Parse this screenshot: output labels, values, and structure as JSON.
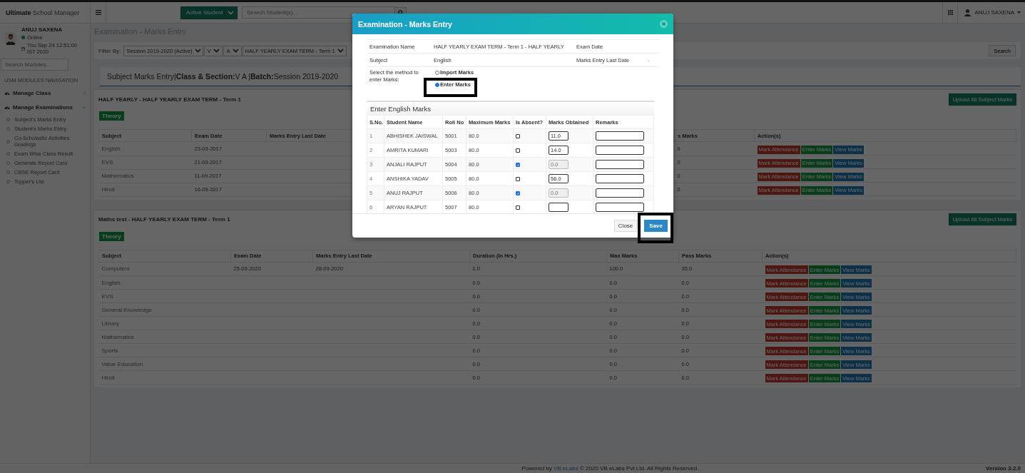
{
  "topbar": {
    "brand": "**Ultimate** School Manager",
    "active_button": "Active Student",
    "search_placeholder": "Search Student(s)...",
    "user": "ANUJ SAXENA"
  },
  "sidebar": {
    "user": "ANUJ SAXENA",
    "status": "Online",
    "datetime": "Thu Sep 24 12:51:00 IST 2020",
    "search_placeholder": "Search Modules...",
    "nav_heading": "USM MODULES NAVIGATION",
    "menus": [
      {
        "label": "Manage Class",
        "expanded": false
      },
      {
        "label": "Manage Examinations",
        "expanded": true,
        "children": [
          {
            "label": "Subject's Marks Entry"
          },
          {
            "label": "Student's Marks Entry"
          },
          {
            "label": "Co-Scholastic Activities Gradings"
          },
          {
            "label": "Exam Wise Class Result"
          },
          {
            "label": "Generate Report Card"
          },
          {
            "label": "CBSE Report Card"
          },
          {
            "label": "Topper's List"
          }
        ]
      }
    ]
  },
  "page_title": "Examination - Marks Entry",
  "filter": {
    "label": "Filter By:",
    "selects": [
      "Session 2019-2020 (Active)",
      "V",
      "A",
      "HALF YEARLY EXAM TERM - Term 1"
    ],
    "button": "Search"
  },
  "heading": "Subject Marks Entry|**Class & Section:**V A |**Batch:**Session 2019-2020",
  "sections": [
    {
      "title": "HALF YEARLY - HALF YEARLY EXAM TERM - Term 1",
      "tab": "Theory",
      "upload_button": "Upload All Subject Marks",
      "columns": [
        "Subject",
        "Exam Date",
        "Marks Entry Last Date",
        null,
        null,
        "s Marks",
        "Action(s)"
      ],
      "rows": [
        {
          "cells": [
            "English",
            "23-09-2017",
            null,
            null,
            null,
            "0"
          ],
          "actions": [
            "Mark Attendance",
            "Enter Marks",
            "View Marks"
          ]
        },
        {
          "cells": [
            "EVS",
            "21-09-2017",
            null,
            null,
            null,
            "0"
          ],
          "actions": [
            "Mark Attendance",
            "Enter Marks",
            "View Marks"
          ]
        },
        {
          "cells": [
            "Mathematics",
            "11-09-2017",
            null,
            null,
            null,
            "0"
          ],
          "actions": [
            "Mark Attendance",
            "Enter Marks",
            "View Marks"
          ]
        },
        {
          "cells": [
            "Hindi",
            "16-09-2017",
            null,
            null,
            null,
            "0"
          ],
          "actions": [
            "Mark Attendance",
            "Enter Marks",
            "View Marks"
          ]
        }
      ]
    },
    {
      "title": "Maths test - HALF YEARLY EXAM TERM - Term 1",
      "tab": "Theory",
      "upload_button": "Upload All Subject Marks",
      "columns": [
        "Subject",
        "Exam Date",
        "Marks Entry Last Date",
        "Duration (In Hrs.)",
        "Max Marks",
        "Pass Marks",
        "Action(s)"
      ],
      "rows": [
        {
          "cells": [
            "Computers",
            "25-09-2020",
            "28-09-2020",
            "1.0",
            "100.0",
            "35.0"
          ],
          "actions": [
            "Mark Attendance",
            "Enter Marks",
            "View Marks"
          ]
        },
        {
          "cells": [
            "English",
            null,
            null,
            "0.0",
            "0.0",
            "0.0"
          ],
          "actions": [
            "Mark Attendance",
            "Enter Marks",
            "View Marks"
          ]
        },
        {
          "cells": [
            "EVS",
            null,
            null,
            "0.0",
            "0.0",
            "0.0"
          ],
          "actions": [
            "Mark Attendance",
            "Enter Marks",
            "View Marks"
          ]
        },
        {
          "cells": [
            "General Knowledge",
            null,
            null,
            "0.0",
            "0.0",
            "0.0"
          ],
          "actions": [
            "Mark Attendance",
            "Enter Marks",
            "View Marks"
          ]
        },
        {
          "cells": [
            "Library",
            null,
            null,
            "0.0",
            "0.0",
            "0.0"
          ],
          "actions": [
            "Mark Attendance",
            "Enter Marks",
            "View Marks"
          ]
        },
        {
          "cells": [
            "Mathematics",
            null,
            null,
            "0.0",
            "0.0",
            "0.0"
          ],
          "actions": [
            "Mark Attendance",
            "Enter Marks",
            "View Marks"
          ]
        },
        {
          "cells": [
            "Sports",
            null,
            null,
            "0.0",
            "0.0",
            "0.0"
          ],
          "actions": [
            "Mark Attendance",
            "Enter Marks",
            "View Marks"
          ]
        },
        {
          "cells": [
            "Value Education",
            null,
            null,
            "0.0",
            "0.0",
            "0.0"
          ],
          "actions": [
            "Mark Attendance",
            "Enter Marks",
            "View Marks"
          ]
        },
        {
          "cells": [
            "Hindi",
            null,
            null,
            "0.0",
            "0.0",
            "0.0"
          ],
          "actions": [
            "Mark Attendance",
            "Enter Marks",
            "View Marks"
          ]
        }
      ]
    }
  ],
  "footer": {
    "before": "Powered by",
    "link": "VB eLabs",
    "after": "© 2020 VB eLabs Pvt Ltd. All Rights Reserved.",
    "version": "Version 3.2.0"
  },
  "modal": {
    "title": "Examination - Marks Entry",
    "info": [
      {
        "label": "Examination Name",
        "value": "HALF YEARLY EXAM TERM - Term 1 - HALF YEARLY",
        "label2": "Exam Date"
      },
      {
        "label": "Subject",
        "value": "English",
        "label2": "Marks Entry Last Date",
        "value2": "-"
      }
    ],
    "method_label": "Select the method to enter Marks:",
    "methods": [
      {
        "label": "Import Marks",
        "selected": false
      },
      {
        "label": "Enter Marks",
        "selected": true
      }
    ],
    "panel_title": "Enter English Marks",
    "columns": [
      "S.No.",
      "Student Name",
      "Roll No",
      "Maximum Marks",
      "Is Absent?",
      "Marks Obtained",
      "Remarks"
    ],
    "students": [
      {
        "sno": "1",
        "name": "ABHISHEK JAISWAL",
        "roll": "5001",
        "max": "80.0",
        "absent": false,
        "marks": "11.0"
      },
      {
        "sno": "2",
        "name": "AMRITA KUMARI",
        "roll": "5003",
        "max": "80.0",
        "absent": false,
        "marks": "14.0"
      },
      {
        "sno": "3",
        "name": "ANJALI RAJPUT",
        "roll": "5004",
        "max": "80.0",
        "absent": true,
        "marks": "0.0"
      },
      {
        "sno": "4",
        "name": "ANSHIKA YADAV",
        "roll": "5005",
        "max": "80.0",
        "absent": false,
        "marks": "56.0"
      },
      {
        "sno": "5",
        "name": "ANUJ RAJPUT",
        "roll": "5006",
        "max": "80.0",
        "absent": true,
        "marks": "0.0"
      },
      {
        "sno": "6",
        "name": "ARYAN RAJPUT",
        "roll": "5007",
        "max": "80.0",
        "absent": false
      }
    ],
    "buttons": [
      "Close",
      "Save"
    ]
  }
}
